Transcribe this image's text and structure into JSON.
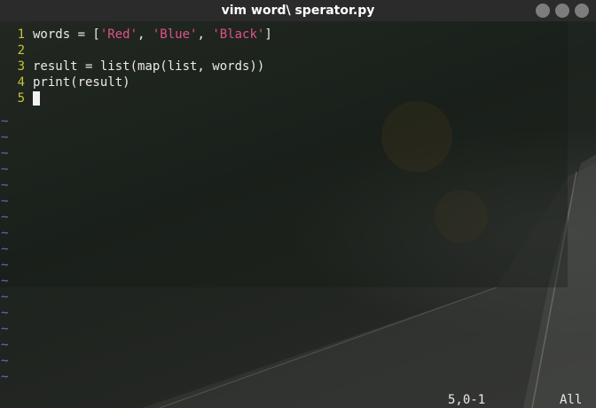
{
  "window": {
    "title": "vim word\\ sperator.py",
    "buttons": [
      "minimize",
      "maximize",
      "close"
    ]
  },
  "editor": {
    "lines": [
      {
        "number": "1",
        "segments": [
          {
            "text": "words = [",
            "kind": "plain"
          },
          {
            "text": "'Red'",
            "kind": "string"
          },
          {
            "text": ", ",
            "kind": "plain"
          },
          {
            "text": "'Blue'",
            "kind": "string"
          },
          {
            "text": ", ",
            "kind": "plain"
          },
          {
            "text": "'Black'",
            "kind": "string"
          },
          {
            "text": "]",
            "kind": "plain"
          }
        ]
      },
      {
        "number": "2",
        "segments": []
      },
      {
        "number": "3",
        "segments": [
          {
            "text": "result = list(map(list, words))",
            "kind": "plain"
          }
        ]
      },
      {
        "number": "4",
        "segments": [
          {
            "text": "print(result)",
            "kind": "plain"
          }
        ]
      },
      {
        "number": "5",
        "segments": [],
        "cursor": true
      }
    ],
    "empty_line_marker": "~",
    "empty_line_count": 17
  },
  "status": {
    "position": "5,0-1",
    "scroll": "All"
  },
  "colors": {
    "line_number": "#c9c23a",
    "string": "#e0538a",
    "tilde": "#6a6ad0",
    "titlebar": "#2b2b2b"
  }
}
